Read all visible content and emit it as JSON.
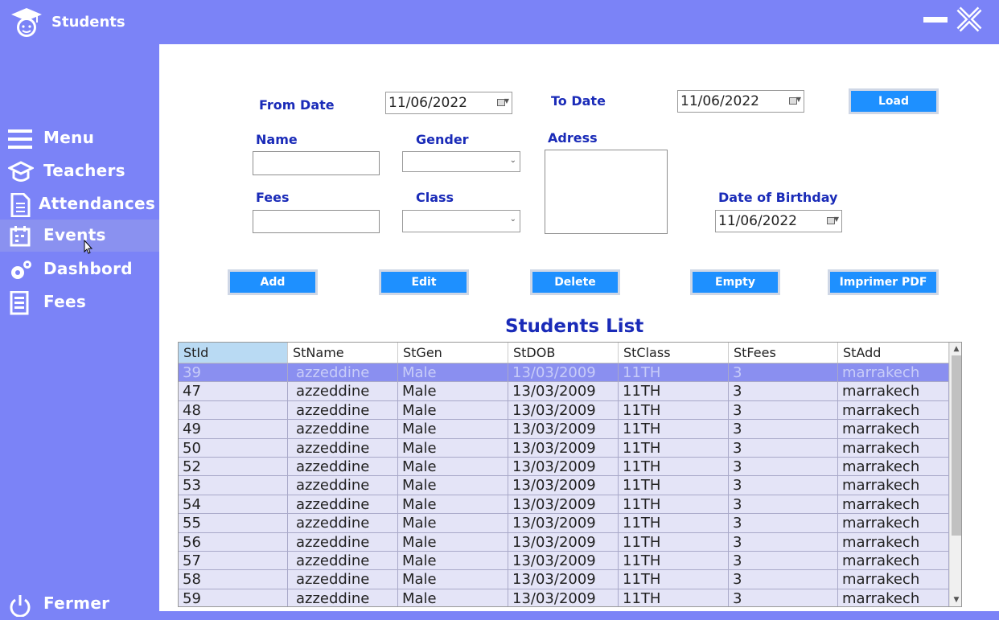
{
  "app": {
    "title": "Students"
  },
  "sidebar": {
    "items": [
      {
        "label": "Menu",
        "icon": "menu-icon"
      },
      {
        "label": "Teachers",
        "icon": "teachers-icon"
      },
      {
        "label": "Attendances",
        "icon": "attendances-icon"
      },
      {
        "label": "Events",
        "icon": "events-icon",
        "active": true
      },
      {
        "label": "Dashbord",
        "icon": "dashboard-gear-icon"
      },
      {
        "label": "Fees",
        "icon": "fees-icon"
      }
    ],
    "logout_label": "Fermer"
  },
  "filter": {
    "from_label": "From Date",
    "from_value": "11/06/2022",
    "to_label": "To Date",
    "to_value": "11/06/2022",
    "load_label": "Load"
  },
  "form": {
    "name_label": "Name",
    "name_value": "",
    "gender_label": "Gender",
    "gender_value": "",
    "address_label": "Adress",
    "address_value": "",
    "fees_label": "Fees",
    "fees_value": "",
    "class_label": "Class",
    "class_value": "",
    "dob_label": "Date of Birthday",
    "dob_value": "11/06/2022"
  },
  "actions": {
    "add": "Add",
    "edit": "Edit",
    "delete": "Delete",
    "empty": "Empty",
    "print": "Imprimer PDF"
  },
  "list": {
    "title": "Students List",
    "columns": [
      "StId",
      "StName",
      "StGen",
      "StDOB",
      "StClass",
      "StFees",
      "StAdd"
    ],
    "rows": [
      [
        "39",
        "azzeddine",
        "Male",
        "13/03/2009",
        "11TH",
        "3",
        "marrakech"
      ],
      [
        "47",
        "azzeddine",
        "Male",
        "13/03/2009",
        "11TH",
        "3",
        "marrakech"
      ],
      [
        "48",
        "azzeddine",
        "Male",
        "13/03/2009",
        "11TH",
        "3",
        "marrakech"
      ],
      [
        "49",
        "azzeddine",
        "Male",
        "13/03/2009",
        "11TH",
        "3",
        "marrakech"
      ],
      [
        "50",
        "azzeddine",
        "Male",
        "13/03/2009",
        "11TH",
        "3",
        "marrakech"
      ],
      [
        "52",
        "azzeddine",
        "Male",
        "13/03/2009",
        "11TH",
        "3",
        "marrakech"
      ],
      [
        "53",
        "azzeddine",
        "Male",
        "13/03/2009",
        "11TH",
        "3",
        "marrakech"
      ],
      [
        "54",
        "azzeddine",
        "Male",
        "13/03/2009",
        "11TH",
        "3",
        "marrakech"
      ],
      [
        "55",
        "azzeddine",
        "Male",
        "13/03/2009",
        "11TH",
        "3",
        "marrakech"
      ],
      [
        "56",
        "azzeddine",
        "Male",
        "13/03/2009",
        "11TH",
        "3",
        "marrakech"
      ],
      [
        "57",
        "azzeddine",
        "Male",
        "13/03/2009",
        "11TH",
        "3",
        "marrakech"
      ],
      [
        "58",
        "azzeddine",
        "Male",
        "13/03/2009",
        "11TH",
        "3",
        "marrakech"
      ],
      [
        "59",
        "azzeddine",
        "Male",
        "13/03/2009",
        "11TH",
        "3",
        "marrakech"
      ]
    ],
    "selected_index": 0
  },
  "colors": {
    "sidebar": "#7b83f7",
    "label_blue": "#1a2bb8",
    "button_blue": "#1e90ff",
    "row_bg": "#e4e4f7",
    "row_selected": "#8a8ff0"
  }
}
